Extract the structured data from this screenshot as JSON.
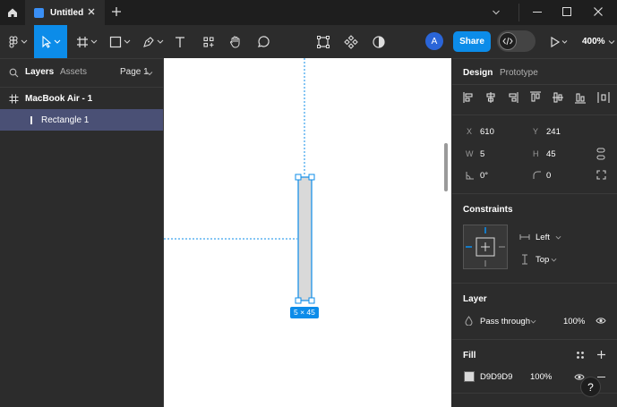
{
  "titlebar": {
    "tab_title": "Untitled"
  },
  "toolbar": {
    "share_label": "Share",
    "avatar_initial": "A",
    "zoom": "400%"
  },
  "left_panel": {
    "tab_layers": "Layers",
    "tab_assets": "Assets",
    "page_selector": "Page 1",
    "layers": [
      {
        "name": "MacBook Air - 1",
        "type": "frame"
      },
      {
        "name": "Rectangle 1",
        "type": "rectangle",
        "selected": true
      }
    ]
  },
  "canvas": {
    "size_label": "5 × 45",
    "selection_color": "#0c8ce9",
    "shape_fill": "#D9D9D9"
  },
  "right_panel": {
    "tab_design": "Design",
    "tab_prototype": "Prototype",
    "x_label": "X",
    "x_value": "610",
    "y_label": "Y",
    "y_value": "241",
    "w_label": "W",
    "w_value": "5",
    "h_label": "H",
    "h_value": "45",
    "rotation_value": "0°",
    "radius_value": "0",
    "constraints_title": "Constraints",
    "constraint_h": "Left",
    "constraint_v": "Top",
    "layer_title": "Layer",
    "blend_mode": "Pass through",
    "layer_opacity": "100%",
    "fill_title": "Fill",
    "fill_hex": "D9D9D9",
    "fill_opacity": "100%"
  },
  "help": "?"
}
